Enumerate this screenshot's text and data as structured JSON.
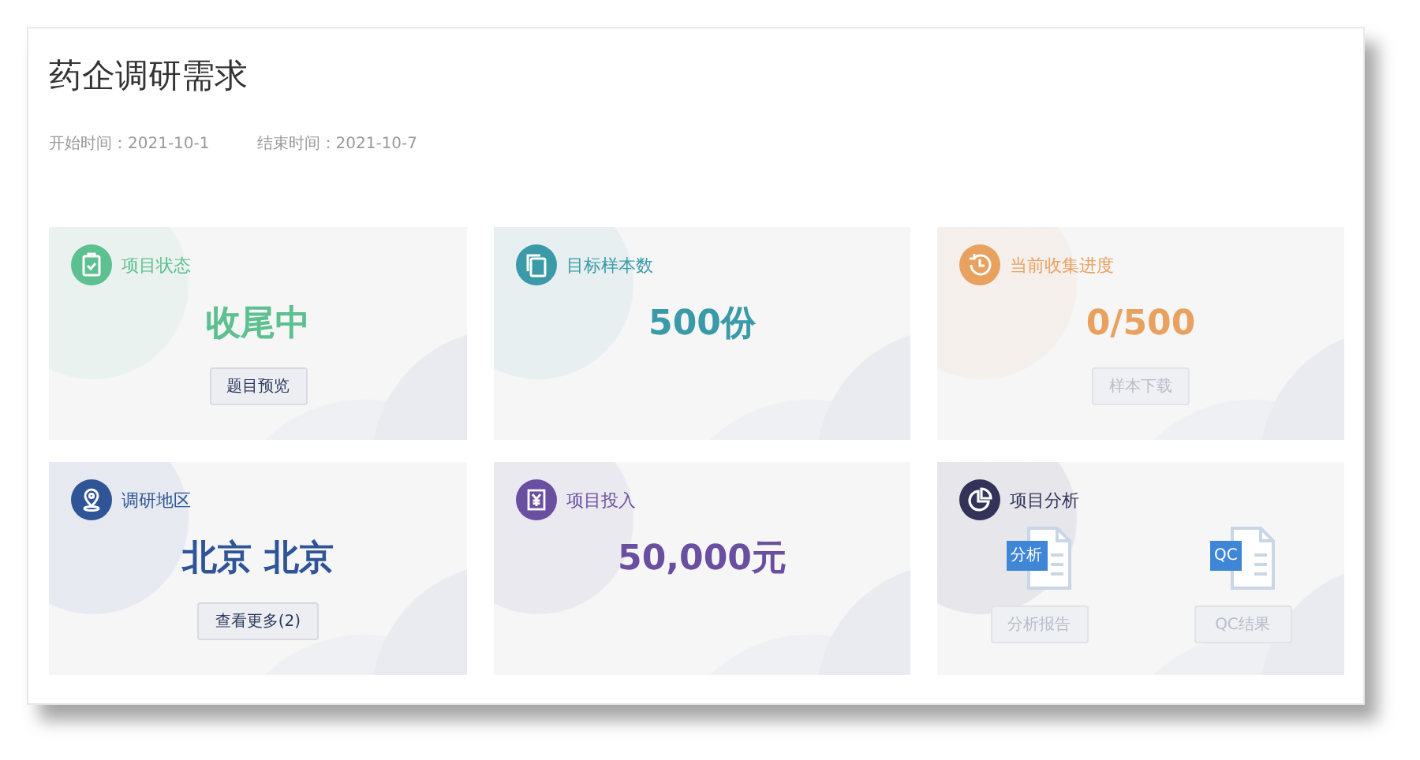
{
  "title": "药企调研需求",
  "dates": [
    {
      "label": "开始时间：",
      "value": "2021-10-1"
    },
    {
      "label": "结束时间：",
      "value": "2021-10-7"
    }
  ],
  "cards": [
    {
      "kind": "status",
      "color": "#5cc08f",
      "title": "项目状态",
      "value": "收尾中",
      "buttons": [
        {
          "label": "题目预览",
          "disabled": false
        }
      ]
    },
    {
      "kind": "samples",
      "color": "#3a9aa8",
      "title": "目标样本数",
      "value": "500份"
    },
    {
      "kind": "progress",
      "color": "#e9a15f",
      "title": "当前收集进度",
      "value": "0/500",
      "buttons": [
        {
          "label": "样本下载",
          "disabled": true
        }
      ]
    },
    {
      "kind": "region",
      "color": "#2f5597",
      "title": "调研地区",
      "value": "北京 北京",
      "buttons": [
        {
          "label": "查看更多(2)",
          "disabled": false
        }
      ]
    },
    {
      "kind": "budget",
      "color": "#6a4fa0",
      "title": "项目投入",
      "value": "50,000元"
    },
    {
      "kind": "analysis",
      "color": "#33335a",
      "title": "项目分析",
      "docs": [
        {
          "tag": "分析",
          "button": {
            "label": "分析报告",
            "disabled": true
          }
        },
        {
          "tag": "QC",
          "button": {
            "label": "QC结果",
            "disabled": true
          }
        }
      ]
    }
  ]
}
